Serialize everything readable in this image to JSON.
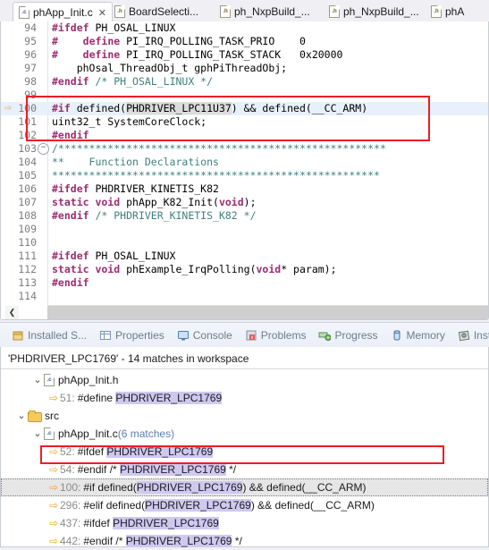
{
  "editor": {
    "tabs": [
      {
        "label": "phApp_Init.c",
        "icon": "c-file-icon",
        "icon_letter": ".c",
        "active": true,
        "close": "✕"
      },
      {
        "label": "BoardSelecti...",
        "icon": "h-file-icon",
        "icon_letter": ".h",
        "active": false
      },
      {
        "label": "ph_NxpBuild_...",
        "icon": "h-file-icon",
        "icon_letter": ".h",
        "active": false
      },
      {
        "label": "ph_NxpBuild_...",
        "icon": "h-file-icon",
        "icon_letter": ".h",
        "active": false
      },
      {
        "label": "phA",
        "icon": "h-file-icon",
        "icon_letter": ".h",
        "active": false
      }
    ],
    "current_line_marker": "⇨",
    "fold_marker": "⊖",
    "scroll_left_arrow": "❮",
    "lines": [
      {
        "n": "94",
        "segments": [
          {
            "t": "#ifdef",
            "c": "pp"
          },
          {
            "t": " PH_OSAL_LINUX",
            "c": ""
          }
        ],
        "hl": false
      },
      {
        "n": "95",
        "segments": [
          {
            "t": "#",
            "c": "pp"
          },
          {
            "t": "    ",
            "c": ""
          },
          {
            "t": "define",
            "c": "pp"
          },
          {
            "t": " PI_IRQ_POLLING_TASK_PRIO    0",
            "c": ""
          }
        ],
        "hl": false
      },
      {
        "n": "96",
        "segments": [
          {
            "t": "#",
            "c": "pp"
          },
          {
            "t": "    ",
            "c": ""
          },
          {
            "t": "define",
            "c": "pp"
          },
          {
            "t": " PI_IRQ_POLLING_TASK_STACK   0x20000",
            "c": ""
          }
        ],
        "hl": false
      },
      {
        "n": "97",
        "segments": [
          {
            "t": "    phOsal_ThreadObj_t gphPiThreadObj;",
            "c": ""
          }
        ],
        "hl": false
      },
      {
        "n": "98",
        "segments": [
          {
            "t": "#endif",
            "c": "pp"
          },
          {
            "t": " ",
            "c": ""
          },
          {
            "t": "/* PH_OSAL_LINUX */",
            "c": "cm"
          }
        ],
        "hl": false
      },
      {
        "n": "99",
        "segments": [],
        "hl": false
      },
      {
        "n": "100",
        "segments": [
          {
            "t": "#if",
            "c": "pp"
          },
          {
            "t": " defined(",
            "c": ""
          },
          {
            "t": "PHDRIVER_LPC11U37",
            "c": "occ"
          },
          {
            "t": ") && defined(__CC_ARM)",
            "c": ""
          }
        ],
        "hl": true,
        "marker": true
      },
      {
        "n": "101",
        "segments": [
          {
            "t": "uint32_t SystemCoreClock;",
            "c": ""
          }
        ],
        "hl": false
      },
      {
        "n": "102",
        "segments": [
          {
            "t": "#endif",
            "c": "pp"
          }
        ],
        "hl": false
      },
      {
        "n": "103",
        "segments": [
          {
            "t": "/*****************************************************",
            "c": "cm"
          }
        ],
        "hl": false,
        "fold": true
      },
      {
        "n": "104",
        "segments": [
          {
            "t": "**    Function Declarations",
            "c": "cm"
          }
        ],
        "hl": false
      },
      {
        "n": "105",
        "segments": [
          {
            "t": "*****************************************************",
            "c": "cm"
          }
        ],
        "hl": false
      },
      {
        "n": "106",
        "segments": [
          {
            "t": "#ifdef",
            "c": "pp"
          },
          {
            "t": " PHDRIVER_KINETIS_K82",
            "c": ""
          }
        ],
        "hl": false
      },
      {
        "n": "107",
        "segments": [
          {
            "t": "static void",
            "c": "ty"
          },
          {
            "t": " phApp_K82_Init(",
            "c": ""
          },
          {
            "t": "void",
            "c": "ty"
          },
          {
            "t": ");",
            "c": ""
          }
        ],
        "hl": false
      },
      {
        "n": "108",
        "segments": [
          {
            "t": "#endif",
            "c": "pp"
          },
          {
            "t": " ",
            "c": ""
          },
          {
            "t": "/* PHDRIVER_KINETIS_K82 */",
            "c": "cm"
          }
        ],
        "hl": false
      },
      {
        "n": "109",
        "segments": [],
        "hl": false
      },
      {
        "n": "110",
        "segments": [],
        "hl": false
      },
      {
        "n": "111",
        "segments": [
          {
            "t": "#ifdef",
            "c": "pp"
          },
          {
            "t": " PH_OSAL_LINUX",
            "c": ""
          }
        ],
        "hl": false
      },
      {
        "n": "112",
        "segments": [
          {
            "t": "static void",
            "c": "ty"
          },
          {
            "t": " phExample_IrqPolling(",
            "c": ""
          },
          {
            "t": "void",
            "c": "ty"
          },
          {
            "t": "* param);",
            "c": ""
          }
        ],
        "hl": false
      },
      {
        "n": "113",
        "segments": [
          {
            "t": "#endif",
            "c": "pp"
          }
        ],
        "hl": false
      },
      {
        "n": "114",
        "segments": [],
        "hl": false
      }
    ]
  },
  "view_tabs": [
    {
      "label": "Installed S...",
      "icon": "installed-software-icon"
    },
    {
      "label": "Properties",
      "icon": "properties-icon"
    },
    {
      "label": "Console",
      "icon": "console-icon"
    },
    {
      "label": "Problems",
      "icon": "problems-icon"
    },
    {
      "label": "Progress",
      "icon": "progress-icon"
    },
    {
      "label": "Memory",
      "icon": "memory-icon"
    },
    {
      "label": "Instruct",
      "icon": "instructions-icon"
    }
  ],
  "search_view": {
    "summary": "'PHDRIVER_LPC1769' - 14 matches in workspace",
    "query": "PHDRIVER_LPC1769",
    "twisty_expanded": "⌄",
    "match_arrow": "⇨",
    "rows": [
      {
        "kind": "file",
        "indent": 3,
        "icon": "c-file-icon",
        "icon_letter": ".c",
        "label": "phApp_Init.h",
        "count": "",
        "sel": false
      },
      {
        "kind": "match",
        "indent": 4,
        "line": "51:",
        "pre": "#define ",
        "hl": "PHDRIVER_LPC1769",
        "post": "",
        "sel": false
      },
      {
        "kind": "folder",
        "indent": 2,
        "icon": "folder-icon",
        "label": "src",
        "count": "",
        "sel": false
      },
      {
        "kind": "file",
        "indent": 3,
        "icon": "c-file-icon",
        "icon_letter": ".c",
        "label": "phApp_Init.c",
        "count": "(6 matches)",
        "sel": false
      },
      {
        "kind": "match",
        "indent": 4,
        "line": "52:",
        "pre": "#ifdef ",
        "hl": "PHDRIVER_LPC1769",
        "post": "",
        "sel": false
      },
      {
        "kind": "match",
        "indent": 4,
        "line": "54:",
        "pre": "#endif /* ",
        "hl": "PHDRIVER_LPC1769",
        "post": " */",
        "sel": false
      },
      {
        "kind": "match",
        "indent": 4,
        "line": "100:",
        "pre": "#if defined(",
        "hl": "PHDRIVER_LPC1769",
        "post": ") && defined(__CC_ARM)",
        "sel": true
      },
      {
        "kind": "match",
        "indent": 4,
        "line": "296:",
        "pre": "#elif defined(",
        "hl": "PHDRIVER_LPC1769",
        "post": ") && defined(__CC_ARM)",
        "sel": false
      },
      {
        "kind": "match",
        "indent": 4,
        "line": "437:",
        "pre": "#ifdef ",
        "hl": "PHDRIVER_LPC1769",
        "post": "",
        "sel": false
      },
      {
        "kind": "match",
        "indent": 4,
        "line": "442:",
        "pre": "#endif /* ",
        "hl": "PHDRIVER_LPC1769",
        "post": " */",
        "sel": false
      }
    ]
  },
  "annotations": {
    "editor_box_color": "#ee1c24",
    "tree_box_color": "#ee1c24"
  }
}
